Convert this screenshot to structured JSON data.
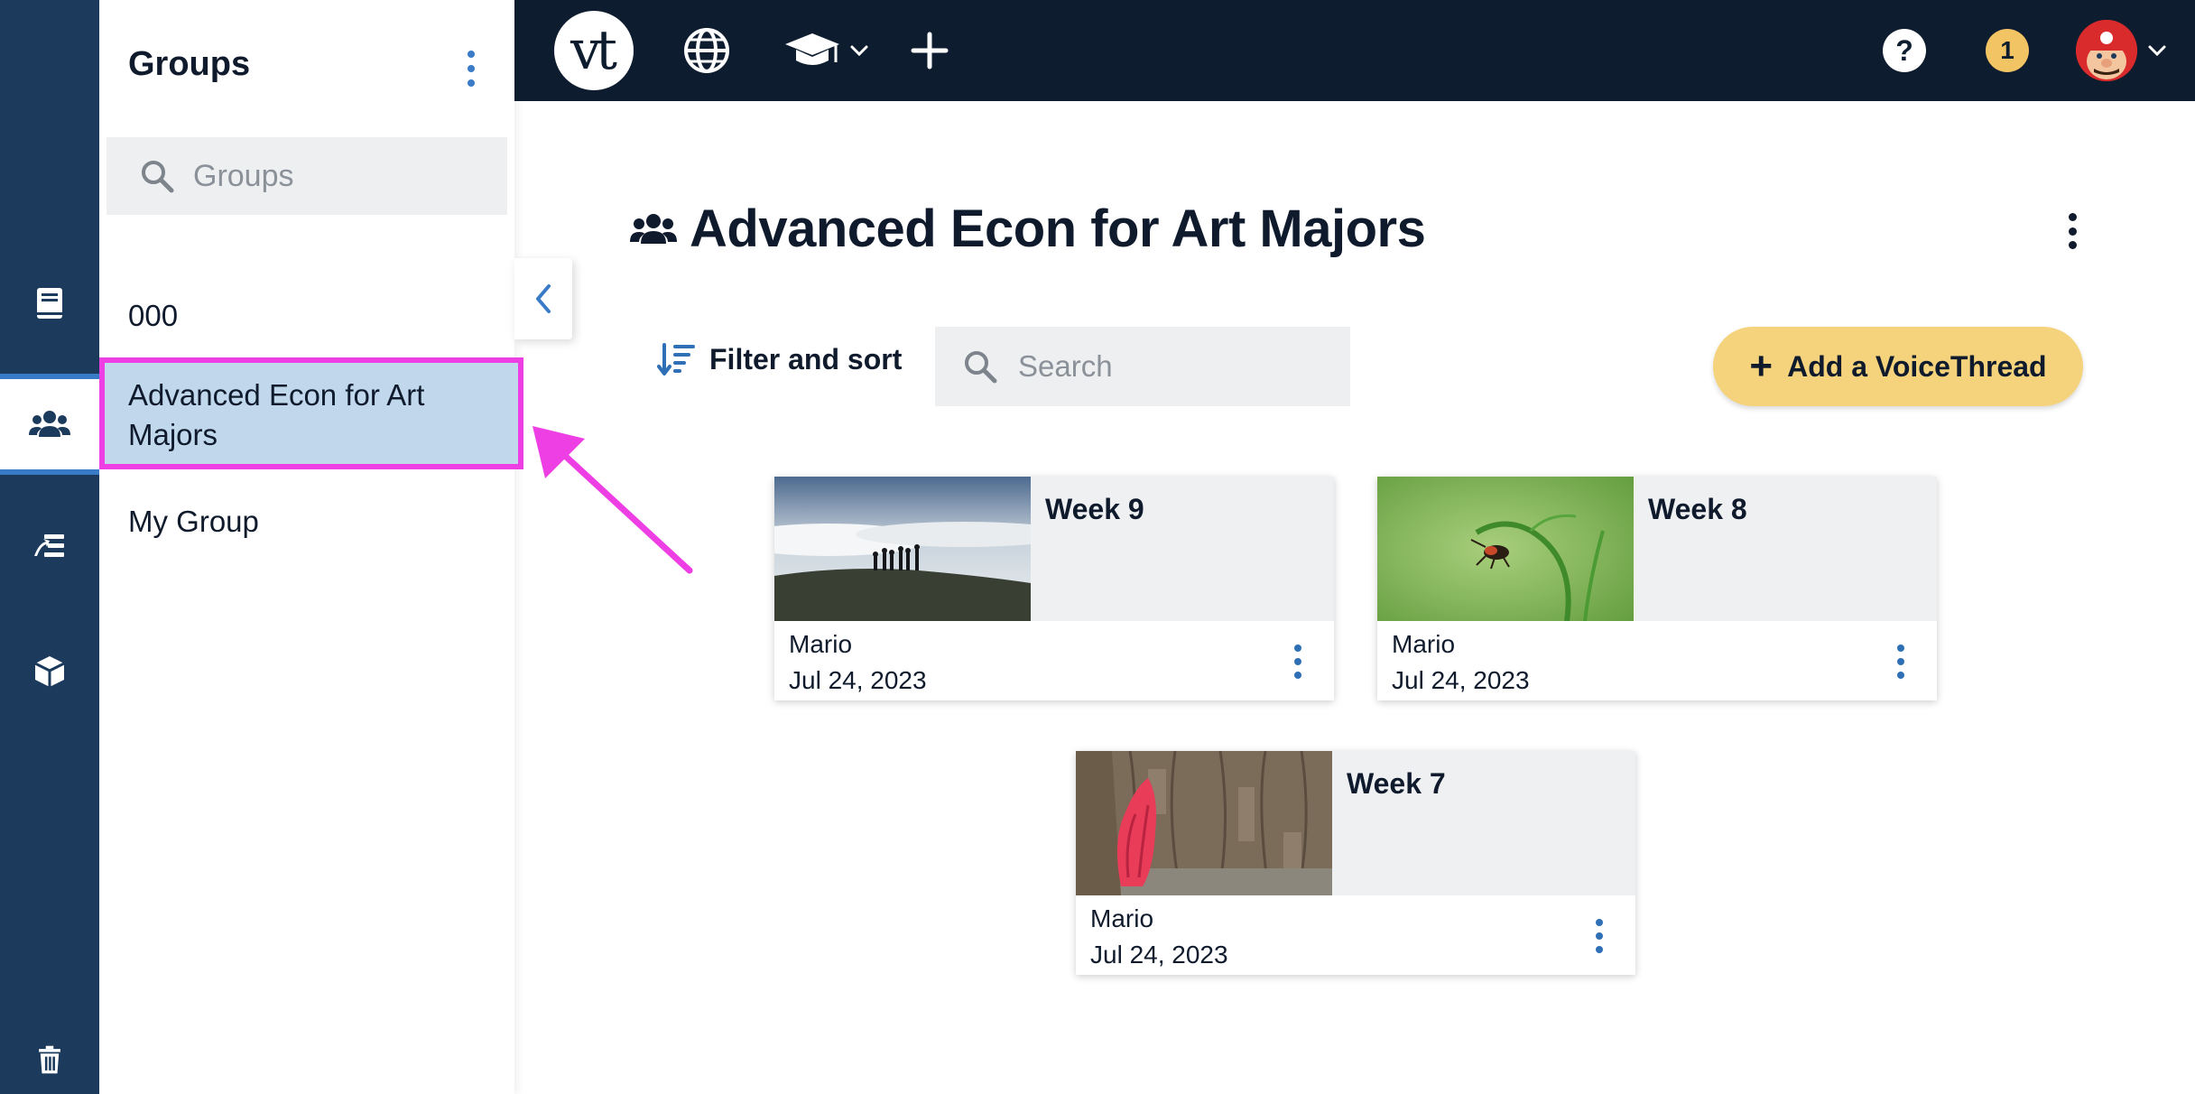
{
  "colors": {
    "rail_bg": "#1b3a5c",
    "topbar_bg": "#0d1c2e",
    "accent_blue": "#3a7bc8",
    "selected_bg": "#c1d7ec",
    "highlight_pink": "#ee3fe4",
    "add_button_bg": "#f5d37c",
    "badge_bg": "#f2c464"
  },
  "rail": {
    "items": [
      {
        "icon": "book-icon"
      },
      {
        "icon": "users-icon",
        "active": true
      },
      {
        "icon": "thread-icon"
      },
      {
        "icon": "cube-icon"
      },
      {
        "icon": "trash-icon"
      }
    ]
  },
  "groups_panel": {
    "title": "Groups",
    "search_placeholder": "Groups",
    "items": [
      {
        "label": "000"
      },
      {
        "label": "Advanced Econ for Art Majors",
        "selected": true
      },
      {
        "label": "My Group"
      }
    ]
  },
  "topbar": {
    "logo_text": "vt",
    "help_label": "?",
    "notification_count": "1"
  },
  "main": {
    "title": "Advanced Econ for Art Majors",
    "filter_label": "Filter and sort",
    "search_placeholder": "Search",
    "add_label": "Add a VoiceThread",
    "cards": [
      {
        "title": "Week 9",
        "author": "Mario",
        "date": "Jul 24, 2023"
      },
      {
        "title": "Week 8",
        "author": "Mario",
        "date": "Jul 24, 2023"
      },
      {
        "title": "Week 7",
        "author": "Mario",
        "date": "Jul 24, 2023"
      }
    ]
  }
}
